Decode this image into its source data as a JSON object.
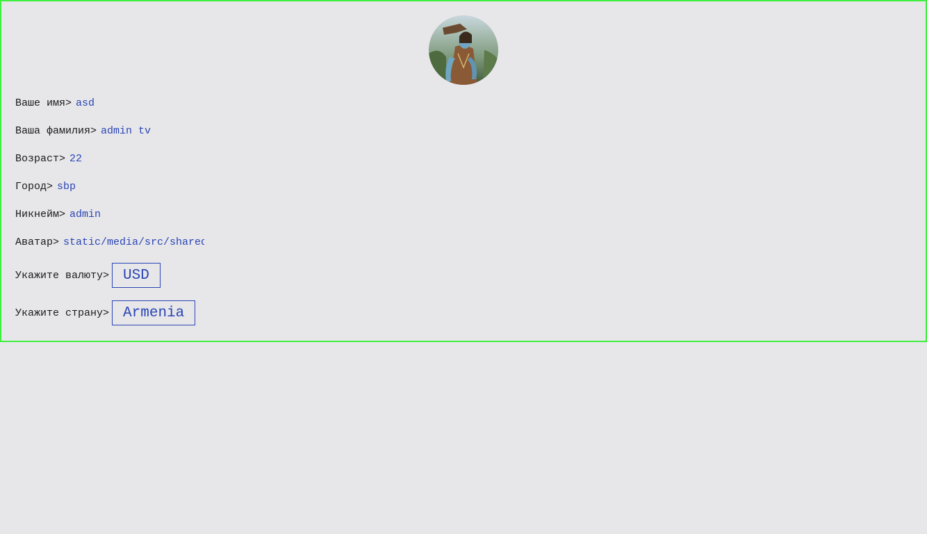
{
  "profile": {
    "fields": [
      {
        "label": "Ваше имя>",
        "value": "asd"
      },
      {
        "label": "Ваша фамилия>",
        "value": "admin tv"
      },
      {
        "label": "Возраст>",
        "value": "22"
      },
      {
        "label": "Город>",
        "value": "sbp"
      },
      {
        "label": "Никнейм>",
        "value": "admin"
      },
      {
        "label": "Аватар>",
        "value": "static/media/src/shared/avatar"
      }
    ],
    "currency": {
      "label": "Укажите валюту>",
      "selected": "USD"
    },
    "country": {
      "label": "Укажите страну>",
      "selected": "Armenia"
    }
  },
  "colors": {
    "frame_border": "#3df03d",
    "background": "#e7e7ea",
    "accent": "#2a44b4",
    "text": "#1a1a1a"
  }
}
